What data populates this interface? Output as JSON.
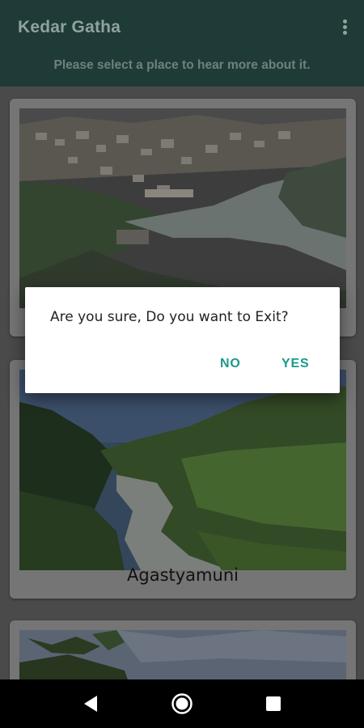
{
  "app_bar": {
    "title": "Kedar Gatha",
    "subtitle": "Please select a place to hear more about it.",
    "menu_icon": "more-vert-icon",
    "background": "#1f3b37"
  },
  "places": [
    {
      "name": "",
      "image_icon": "river-confluence-photo"
    },
    {
      "name": "Agastyamuni",
      "image_icon": "river-valley-photo"
    },
    {
      "name": "",
      "image_icon": "sky-trees-photo"
    }
  ],
  "dialog": {
    "message": "Are you sure, Do you want to Exit?",
    "no_label": "NO",
    "yes_label": "YES",
    "accent": "#1a9a8c"
  },
  "nav_bar": {
    "back_icon": "back-icon",
    "home_icon": "home-icon",
    "recents_icon": "recents-icon"
  }
}
